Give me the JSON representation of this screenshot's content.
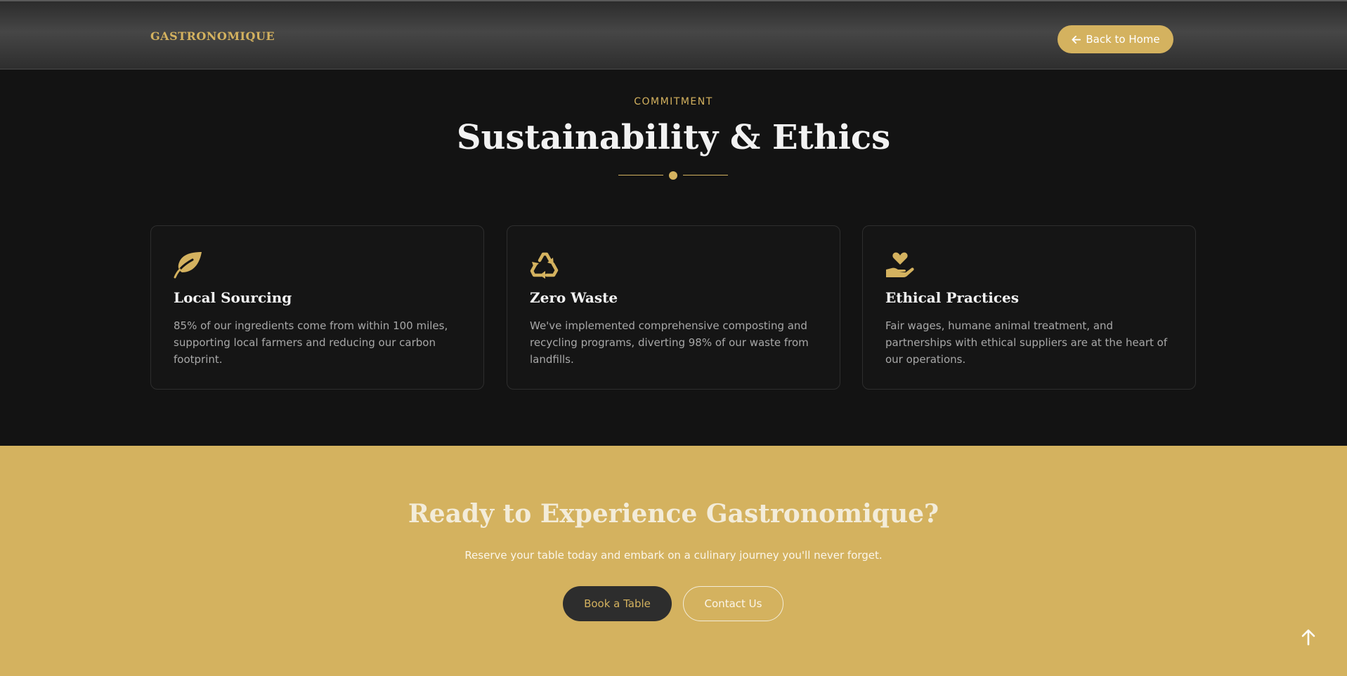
{
  "header": {
    "logo": "GASTRONOMIQUE",
    "back_button": "Back to Home"
  },
  "section": {
    "eyebrow": "COMMITMENT",
    "title": "Sustainability & Ethics",
    "cards": [
      {
        "icon": "leaf-icon",
        "title": "Local Sourcing",
        "description": "85% of our ingredients come from within 100 miles, supporting local farmers and reducing our carbon footprint."
      },
      {
        "icon": "recycle-icon",
        "title": "Zero Waste",
        "description": "We've implemented comprehensive composting and recycling programs, diverting 98% of our waste from landfills."
      },
      {
        "icon": "hand-holding-heart-icon",
        "title": "Ethical Practices",
        "description": "Fair wages, humane animal treatment, and partnerships with ethical suppliers are at the heart of our operations."
      }
    ]
  },
  "cta": {
    "title": "Ready to Experience Gastronomique?",
    "subtitle": "Reserve your table today and embark on a culinary journey you'll never forget.",
    "book_button": "Book a Table",
    "contact_button": "Contact Us"
  },
  "colors": {
    "accent": "#d4b25f",
    "background": "#131313",
    "card_border": "#2e2e2e",
    "dark_button": "#2d2d2d"
  },
  "icons": {
    "back": "arrow-left-icon",
    "scroll_top": "arrow-up-icon"
  }
}
